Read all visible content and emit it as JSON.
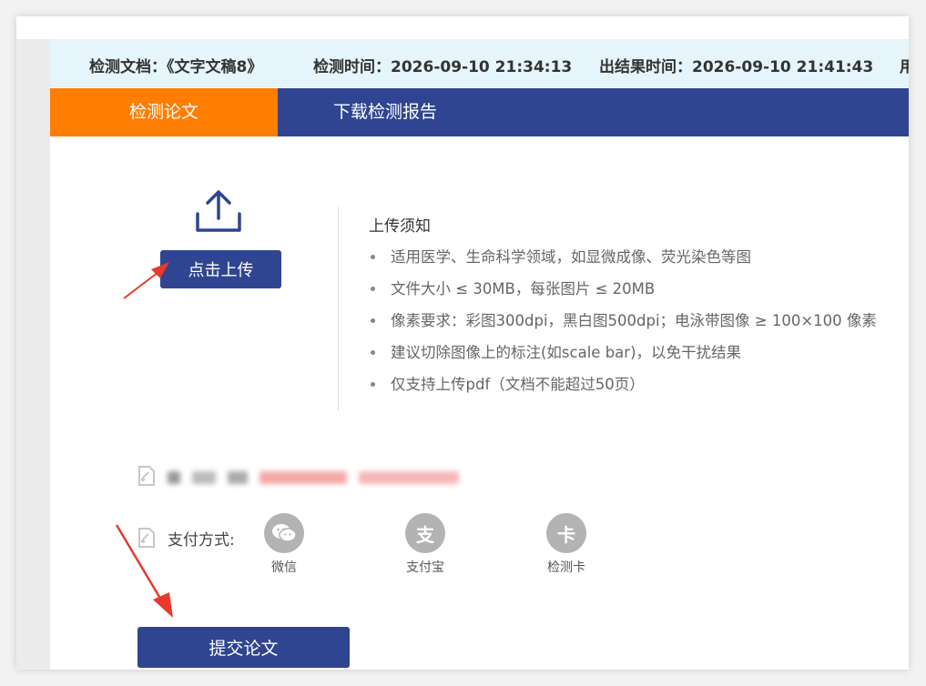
{
  "info_bar": {
    "doc_label": "检测文档：",
    "doc_name": "《文字文稿8》",
    "check_time_label": "检测时间：",
    "check_time": "2026-09-10 21:34:13",
    "result_time_label": "出结果时间：",
    "result_time": "2026-09-10 21:41:43",
    "cutoff": "用"
  },
  "tabs": [
    {
      "label": "检测论文",
      "active": true
    },
    {
      "label": "下载检测报告",
      "active": false
    }
  ],
  "upload": {
    "button_label": "点击上传",
    "icon": "upload-icon"
  },
  "notice": {
    "title": "上传须知",
    "items": [
      "适用医学、生命科学领域，如显微成像、荧光染色等图",
      "文件大小 ≤ 30MB，每张图片 ≤ 20MB",
      "像素要求：彩图300dpi，黑白图500dpi；电泳带图像 ≥ 100×100 像素",
      "建议切除图像上的标注(如scale bar)，以免干扰结果",
      "仅支持上传pdf（文档不能超过50页）"
    ]
  },
  "payment": {
    "label": "支付方式:",
    "options": [
      {
        "label": "微信",
        "icon": "wechat-icon"
      },
      {
        "label": "支付宝",
        "icon": "alipay-icon",
        "glyph": "支"
      },
      {
        "label": "检测卡",
        "icon": "card-icon",
        "glyph": "卡"
      }
    ]
  },
  "submit": {
    "label": "提交论文"
  },
  "colors": {
    "primary": "#2f4591",
    "accent": "#ff7d00",
    "info_bg": "#e6f4fb",
    "annotation_red": "#e8392c"
  }
}
